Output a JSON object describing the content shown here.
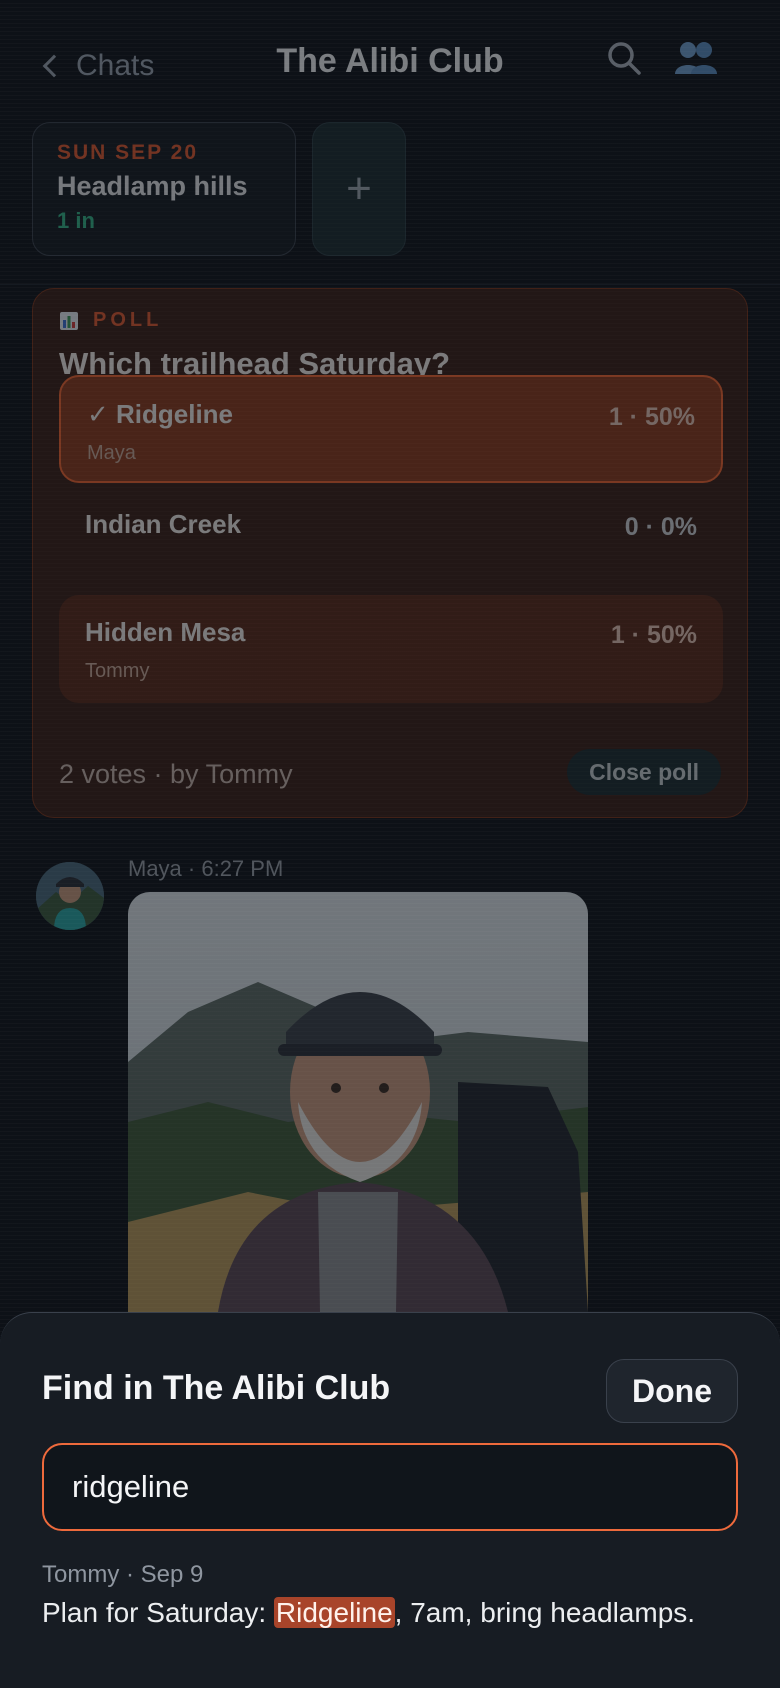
{
  "header": {
    "back_label": "Chats",
    "title": "The Alibi Club",
    "search_icon": "search-icon",
    "members_icon": "people-icon"
  },
  "events": [
    {
      "date": "SUN SEP 20",
      "name": "Headlamp hills",
      "count": "1 in"
    }
  ],
  "add_event_label": "+",
  "poll": {
    "tag": "POLL",
    "question": "Which trailhead Saturday?",
    "options": [
      {
        "label": "✓ Ridgeline",
        "stat": "1 · 50%",
        "voter": "Maya"
      },
      {
        "label": "Indian Creek",
        "stat": "0 · 0%",
        "voter": ""
      },
      {
        "label": "Hidden Mesa",
        "stat": "1 · 50%",
        "voter": "Tommy"
      }
    ],
    "footer": "2 votes · by Tommy",
    "close_label": "Close poll"
  },
  "message": {
    "meta": "Maya · 6:27 PM"
  },
  "find": {
    "title": "Find in The Alibi Club",
    "done_label": "Done",
    "query": "ridgeline",
    "result": {
      "meta": "Tommy · Sep 9",
      "before": "Plan for Saturday: ",
      "match": "Ridgeline",
      "after": ", 7am, bring headlamps."
    }
  },
  "colors": {
    "accent": "#ee6a3c",
    "event_date": "#e0582e",
    "event_count": "#34b487",
    "background": "#0d1117"
  }
}
